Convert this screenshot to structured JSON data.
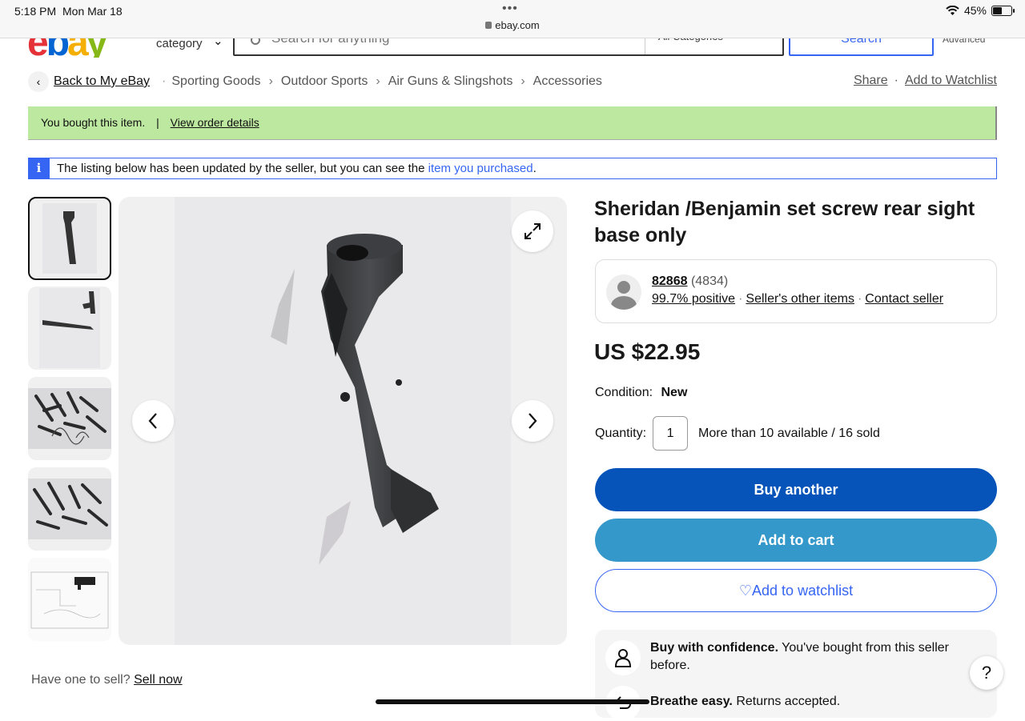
{
  "status": {
    "time": "5:18 PM",
    "date": "Mon Mar 18",
    "dots": "•••",
    "url": "ebay.com",
    "battery": "45%"
  },
  "header": {
    "shop_by_category": "category",
    "search_placeholder": "Search for anything",
    "category_select": "All Categories",
    "search_button": "Search",
    "advanced": "Advanced"
  },
  "breadcrumb": {
    "back": "Back to My eBay",
    "items": [
      "Sporting Goods",
      "Outdoor Sports",
      "Air Guns & Slingshots",
      "Accessories"
    ],
    "share": "Share",
    "add_to_watchlist": "Add to Watchlist"
  },
  "bought_banner": {
    "text": "You bought this item.",
    "sep": "|",
    "link": "View order details"
  },
  "info_banner": {
    "icon": "i",
    "text": "The listing below has been updated by the seller, but you can see the ",
    "link": "item you purchased",
    "end": "."
  },
  "listing": {
    "title": "Sheridan /Benjamin set screw rear sight base only",
    "seller": {
      "name": "82868",
      "count": "(4834)",
      "positive": "99.7% positive",
      "other_items": "Seller's other items",
      "contact": "Contact seller"
    },
    "price": "US $22.95",
    "condition_label": "Condition:",
    "condition_value": "New",
    "quantity_label": "Quantity:",
    "quantity_value": "1",
    "availability": "More than 10 available / 16 sold",
    "buy_another": "Buy another",
    "add_to_cart": "Add to cart",
    "add_to_watchlist": "Add to watchlist",
    "confidence_bold": "Buy with confidence.",
    "confidence_text": " You've bought from this seller before.",
    "returns_bold": "Breathe easy.",
    "returns_text": " Returns accepted."
  },
  "sell": {
    "text": "Have one to sell?",
    "link": "Sell now"
  },
  "help": "?",
  "colors": {
    "ebay_blue": "#3665f3",
    "buy_button": "#0654ba",
    "cart_button": "#3498ca",
    "banner_green": "#bde8a0"
  }
}
